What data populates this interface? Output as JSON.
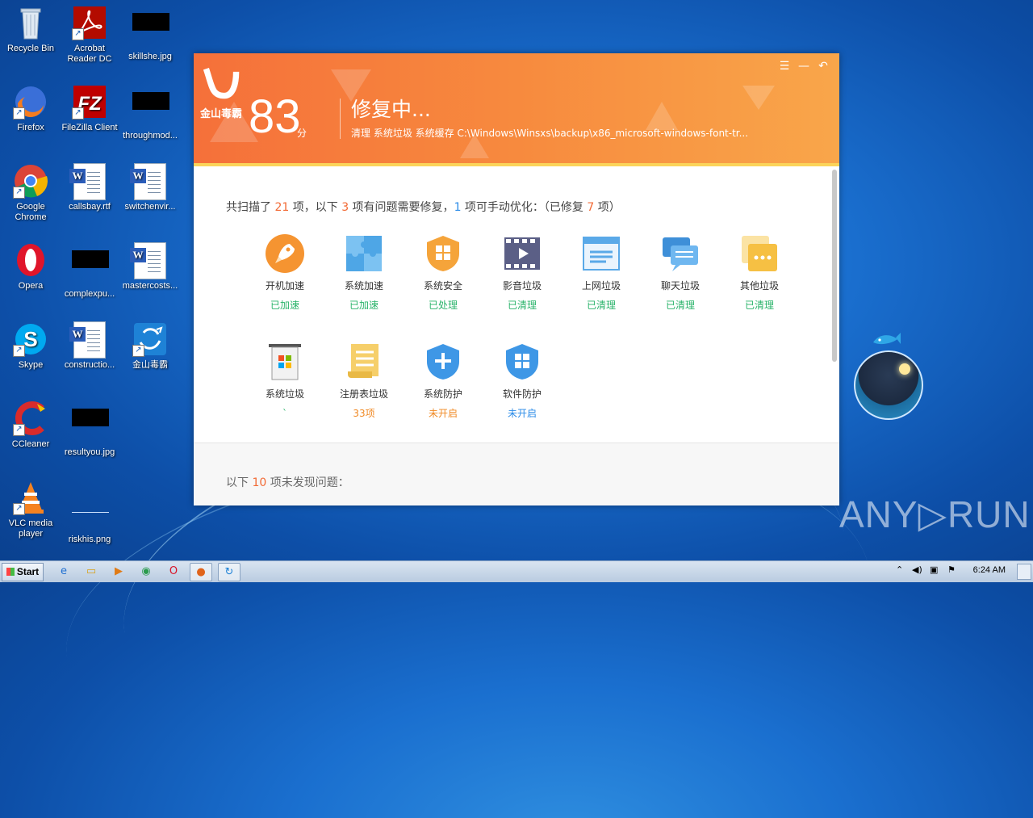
{
  "desktop": {
    "icons": [
      {
        "label": "Recycle Bin",
        "icon": "recycle-bin-icon"
      },
      {
        "label": "Acrobat Reader DC",
        "icon": "acrobat-icon"
      },
      {
        "label": "skillshe.jpg",
        "icon": "image-file-icon"
      },
      {
        "label": "Firefox",
        "icon": "firefox-icon"
      },
      {
        "label": "FileZilla Client",
        "icon": "filezilla-icon"
      },
      {
        "label": "throughmod...",
        "icon": "image-file-icon"
      },
      {
        "label": "Google Chrome",
        "icon": "chrome-icon"
      },
      {
        "label": "callsbay.rtf",
        "icon": "word-doc-icon"
      },
      {
        "label": "switchenvir...",
        "icon": "word-doc-icon"
      },
      {
        "label": "Opera",
        "icon": "opera-icon"
      },
      {
        "label": "complexpu...",
        "icon": "image-file-icon"
      },
      {
        "label": "mastercosts...",
        "icon": "word-doc-icon"
      },
      {
        "label": "Skype",
        "icon": "skype-icon"
      },
      {
        "label": "constructio...",
        "icon": "word-doc-icon"
      },
      {
        "label": "金山毒霸",
        "icon": "duba-icon"
      },
      {
        "label": "CCleaner",
        "icon": "ccleaner-icon"
      },
      {
        "label": "resultyou.jpg",
        "icon": "image-file-icon"
      },
      {
        "label": "VLC media player",
        "icon": "vlc-icon"
      },
      {
        "label": "riskhis.png",
        "icon": "image-file-icon"
      }
    ]
  },
  "app": {
    "title": "金山毒霸",
    "controls": {
      "menu": "☰",
      "minimize": "—",
      "back": "↶"
    },
    "score": "83",
    "score_unit": "分",
    "status_title": "修复中...",
    "status_path": "清理 系统垃圾 系统缓存 C:\\Windows\\Winsxs\\backup\\x86_microsoft-windows-font-tr...",
    "summary": {
      "part1": "共扫描了 ",
      "scanned": "21",
      "part2": " 项，以下 ",
      "problems": "3",
      "part3": " 项有问题需要修复，",
      "manual": "1",
      "part4": " 项可手动优化：（已修复 ",
      "fixed": "7",
      "part5": " 项）"
    },
    "tiles": [
      {
        "name": "开机加速",
        "status": "已加速",
        "icon": "rocket-icon"
      },
      {
        "name": "系统加速",
        "status": "已加速",
        "icon": "puzzle-icon"
      },
      {
        "name": "系统安全",
        "status": "已处理",
        "icon": "windows-shield-icon"
      },
      {
        "name": "影音垃圾",
        "status": "已清理",
        "icon": "film-icon"
      },
      {
        "name": "上网垃圾",
        "status": "已清理",
        "icon": "browser-window-icon"
      },
      {
        "name": "聊天垃圾",
        "status": "已清理",
        "icon": "chat-bubbles-icon"
      },
      {
        "name": "其他垃圾",
        "status": "已清理",
        "icon": "folder-dots-icon"
      },
      {
        "name": "系统垃圾",
        "status": "`",
        "icon": "windows-trash-icon"
      },
      {
        "name": "注册表垃圾",
        "status": "33项",
        "icon": "scroll-icon"
      },
      {
        "name": "系统防护",
        "status": "未开启",
        "icon": "plus-shield-icon"
      },
      {
        "name": "软件防护",
        "status": "未开启",
        "icon": "grid-shield-icon"
      }
    ],
    "footer": {
      "part1": "以下 ",
      "count": "10",
      "part2": " 项未发现问题："
    }
  },
  "taskbar": {
    "start_label": "Start",
    "clock": "6:24 AM"
  },
  "watermark": "ANY▷RUN",
  "colors": {
    "accent_orange": "#f26a35",
    "green": "#29b36a",
    "blue": "#2c8ce8"
  }
}
